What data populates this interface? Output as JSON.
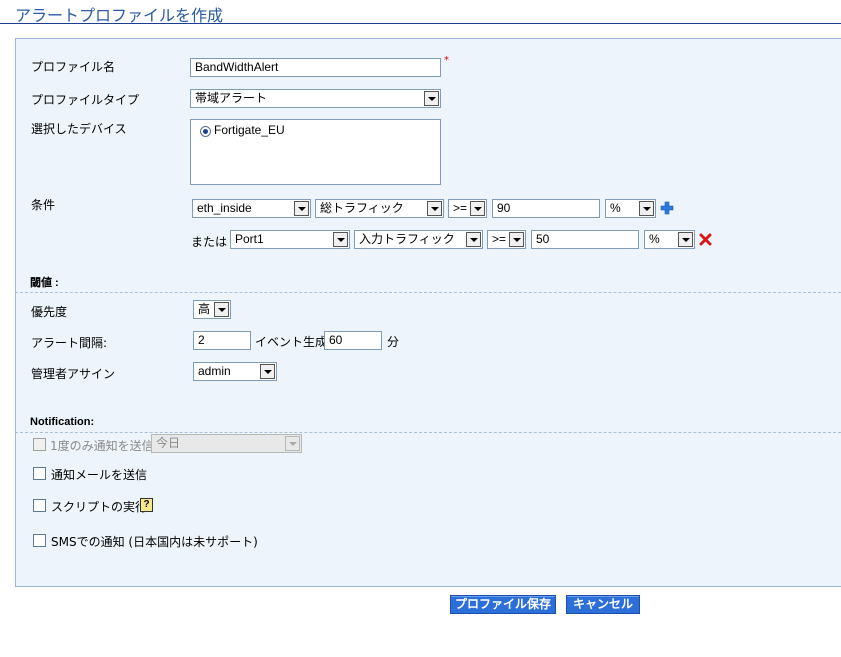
{
  "page_title": "アラートプロファイルを作成",
  "profile_name": {
    "label": "プロファイル名",
    "value": "BandWidthAlert",
    "required_mark": "*"
  },
  "profile_type": {
    "label": "プロファイルタイプ",
    "value": "帯域アラート"
  },
  "devices": {
    "label": "選択したデバイス",
    "items": [
      {
        "label": "Fortigate_EU",
        "selected": true
      }
    ]
  },
  "condition": {
    "label": "条件",
    "or_label": "または",
    "rows": [
      {
        "interface": "eth_inside",
        "traffic": "総トラフィック",
        "operator": ">=",
        "value": "90",
        "unit": "%"
      },
      {
        "interface": "Port1",
        "traffic": "入力トラフィック",
        "operator": ">=",
        "value": "50",
        "unit": "%"
      }
    ]
  },
  "threshold": {
    "heading": "閾値 :",
    "priority": {
      "label": "優先度",
      "value": "高"
    },
    "interval": {
      "label": "アラート間隔:",
      "value": "2",
      "event_label": "イベント生成",
      "event_value": "60",
      "unit": "分"
    },
    "admin": {
      "label": "管理者アサイン",
      "value": "admin"
    }
  },
  "notification": {
    "heading": "Notification:",
    "once": {
      "label": "1度のみ通知を送信",
      "select_value": "今日",
      "enabled": false
    },
    "email": {
      "label": "通知メールを送信"
    },
    "script": {
      "label": "スクリプトの実行",
      "help": "?"
    },
    "sms": {
      "label": "SMSでの通知 (日本国内は未サポート)"
    }
  },
  "buttons": {
    "save": "プロファイル保存",
    "cancel": "キャンセル"
  },
  "colors": {
    "title": "#2a5aa8",
    "button": "#2d6fd8",
    "panel_bg": "#eef4fb",
    "delete": "#d81818",
    "add": "#2f7be0"
  },
  "icons": {
    "add_condition": "plus-icon",
    "remove_condition": "close-icon",
    "help": "help-icon"
  }
}
